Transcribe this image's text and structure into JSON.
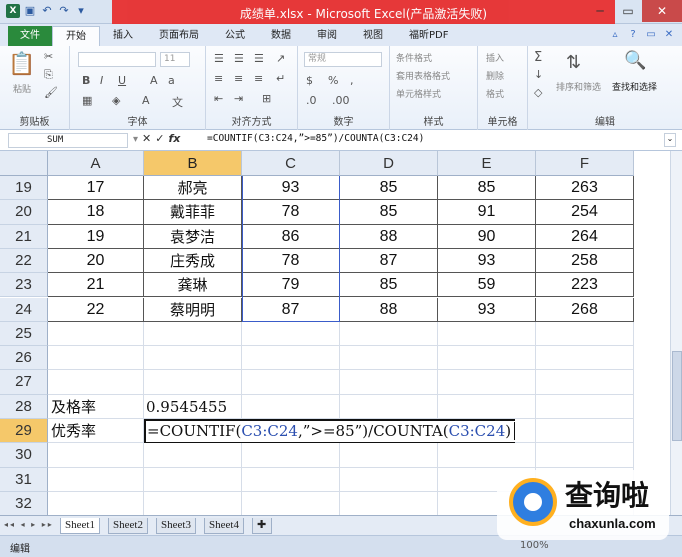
{
  "window": {
    "title": "成绩单.xlsx - Microsoft Excel(产品激活失败)"
  },
  "ribbon": {
    "tabs": [
      "文件",
      "开始",
      "插入",
      "页面布局",
      "公式",
      "数据",
      "审阅",
      "视图",
      "福昕PDF"
    ],
    "active_tab": "开始",
    "groups": {
      "clipboard": {
        "label": "剪贴板",
        "paste": "粘贴"
      },
      "font": {
        "label": "字体",
        "size": "11"
      },
      "alignment": {
        "label": "对齐方式"
      },
      "number": {
        "label": "数字",
        "format": "常规"
      },
      "styles": {
        "label": "样式",
        "items": [
          "条件格式",
          "套用表格格式",
          "单元格样式"
        ]
      },
      "cells": {
        "label": "单元格",
        "items": [
          "插入",
          "删除",
          "格式"
        ]
      },
      "editing": {
        "label": "编辑",
        "sort": "排序和筛选",
        "find": "查找和选择"
      }
    }
  },
  "formula_bar": {
    "name_box": "SUM",
    "formula": "=COUNTIF(C3:C24,”>=85”)/COUNTA(C3:C24)",
    "fx": "fx"
  },
  "columns": [
    "A",
    "B",
    "C",
    "D",
    "E",
    "F"
  ],
  "selected_column": "B",
  "rows": [
    {
      "num": "19",
      "A": "17",
      "B": "郝亮",
      "C": "93",
      "D": "85",
      "E": "85",
      "F": "263"
    },
    {
      "num": "20",
      "A": "18",
      "B": "戴菲菲",
      "C": "78",
      "D": "85",
      "E": "91",
      "F": "254"
    },
    {
      "num": "21",
      "A": "19",
      "B": "袁梦洁",
      "C": "86",
      "D": "88",
      "E": "90",
      "F": "264"
    },
    {
      "num": "22",
      "A": "20",
      "B": "庄秀成",
      "C": "78",
      "D": "87",
      "E": "93",
      "F": "258"
    },
    {
      "num": "23",
      "A": "21",
      "B": "龚琳",
      "C": "79",
      "D": "85",
      "E": "59",
      "F": "223"
    },
    {
      "num": "24",
      "A": "22",
      "B": "蔡明明",
      "C": "87",
      "D": "88",
      "E": "93",
      "F": "268"
    },
    {
      "num": "25"
    },
    {
      "num": "26"
    },
    {
      "num": "27"
    },
    {
      "num": "28",
      "A": "及格率",
      "B": "0.9545455"
    },
    {
      "num": "29",
      "A": "优秀率"
    },
    {
      "num": "30"
    },
    {
      "num": "31"
    },
    {
      "num": "32"
    }
  ],
  "selected_row": "29",
  "edit_cell": {
    "prefix": "=COUNTIF(",
    "ref1": "C3:C24",
    "mid": ",”>=85”)/COUNTA(",
    "ref2": "C3:C24",
    "suffix": ")"
  },
  "sheets": [
    "Sheet1",
    "Sheet2",
    "Sheet3",
    "Sheet4"
  ],
  "active_sheet": "Sheet1",
  "status": {
    "mode": "编辑",
    "zoom": "100%"
  },
  "watermark": {
    "brand": "查询啦",
    "domain": "chaxunla.com"
  },
  "colors": {
    "accent": "#2a8a3c",
    "selection_header": "#f5c86a",
    "title_highlight": "#e82a2a",
    "reference_blue": "#2b4fb0"
  }
}
